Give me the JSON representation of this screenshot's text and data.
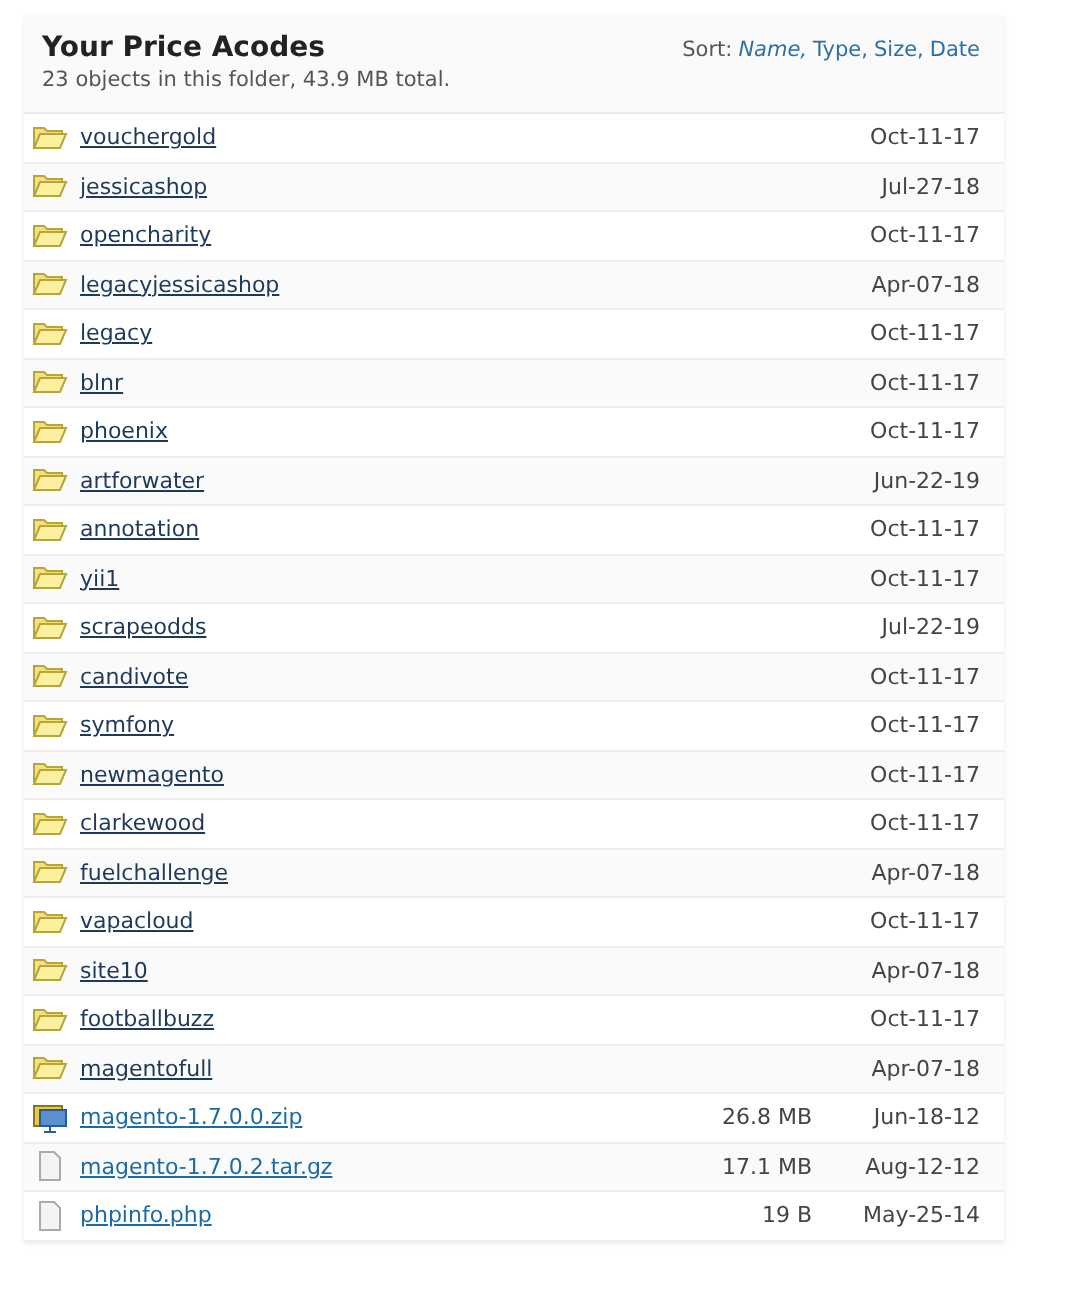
{
  "header": {
    "title": "Your Price Acodes",
    "summary": "23 objects in this folder, 43.9 MB total.",
    "sort_label": "Sort:",
    "sort_options": [
      {
        "label": "Name",
        "selected": true,
        "separator": ","
      },
      {
        "label": "Type",
        "selected": false,
        "separator": ","
      },
      {
        "label": "Size",
        "selected": false,
        "separator": ","
      },
      {
        "label": "Date",
        "selected": false
      }
    ]
  },
  "items": [
    {
      "kind": "folder",
      "name": "vouchergold",
      "date": "Oct-11-17"
    },
    {
      "kind": "folder",
      "name": "jessicashop",
      "date": "Jul-27-18"
    },
    {
      "kind": "folder",
      "name": "opencharity",
      "date": "Oct-11-17"
    },
    {
      "kind": "folder",
      "name": "legacyjessicashop",
      "date": "Apr-07-18"
    },
    {
      "kind": "folder",
      "name": "legacy",
      "date": "Oct-11-17"
    },
    {
      "kind": "folder",
      "name": "blnr",
      "date": "Oct-11-17"
    },
    {
      "kind": "folder",
      "name": "phoenix",
      "date": "Oct-11-17"
    },
    {
      "kind": "folder",
      "name": "artforwater",
      "date": "Jun-22-19"
    },
    {
      "kind": "folder",
      "name": "annotation",
      "date": "Oct-11-17"
    },
    {
      "kind": "folder",
      "name": "yii1",
      "date": "Oct-11-17"
    },
    {
      "kind": "folder",
      "name": "scrapeodds",
      "date": "Jul-22-19"
    },
    {
      "kind": "folder",
      "name": "candivote",
      "date": "Oct-11-17"
    },
    {
      "kind": "folder",
      "name": "symfony",
      "date": "Oct-11-17"
    },
    {
      "kind": "folder",
      "name": "newmagento",
      "date": "Oct-11-17"
    },
    {
      "kind": "folder",
      "name": "clarkewood",
      "date": "Oct-11-17"
    },
    {
      "kind": "folder",
      "name": "fuelchallenge",
      "date": "Apr-07-18"
    },
    {
      "kind": "folder",
      "name": "vapacloud",
      "date": "Oct-11-17"
    },
    {
      "kind": "folder",
      "name": "site10",
      "date": "Apr-07-18"
    },
    {
      "kind": "folder",
      "name": "footballbuzz",
      "date": "Oct-11-17"
    },
    {
      "kind": "folder",
      "name": "magentofull",
      "date": "Apr-07-18"
    },
    {
      "kind": "archive",
      "name": "magento-1.7.0.0.zip",
      "size": "26.8 MB",
      "date": "Jun-18-12"
    },
    {
      "kind": "file",
      "name": "magento-1.7.0.2.tar.gz",
      "size": "17.1 MB",
      "date": "Aug-12-12"
    },
    {
      "kind": "file",
      "name": "phpinfo.php",
      "size": "19 B",
      "date": "May-25-14"
    }
  ]
}
